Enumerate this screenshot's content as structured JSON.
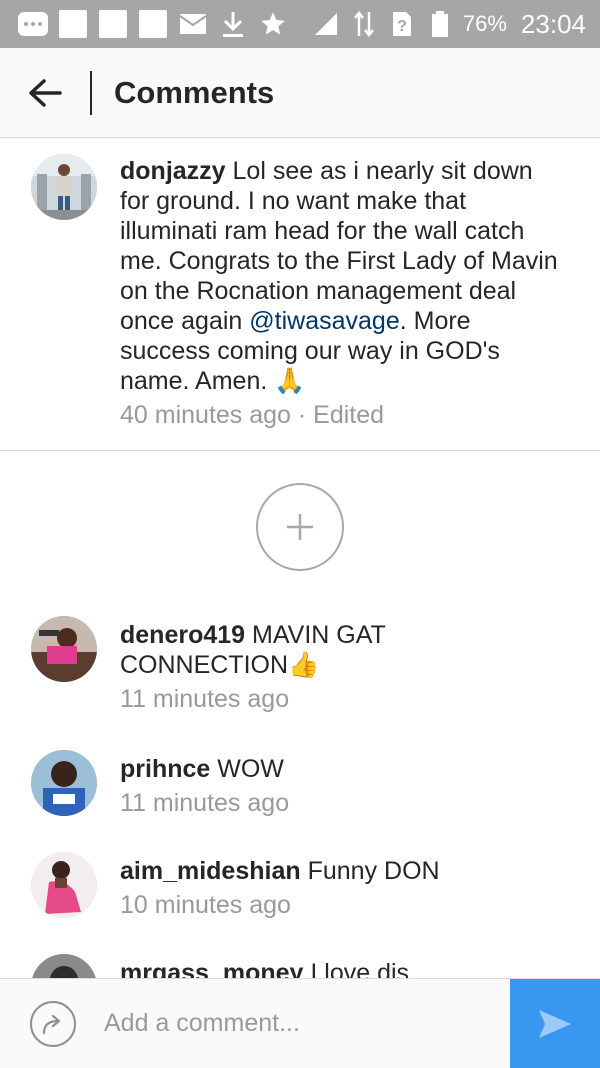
{
  "status_bar": {
    "battery": "76%",
    "time": "23:04"
  },
  "header": {
    "title": "Comments"
  },
  "caption": {
    "username": "donjazzy",
    "text_before_mention": " Lol see as i nearly sit down for ground. I no want make that illuminati ram head for the wall catch me. Congrats to the First Lady of Mavin on the Rocnation management deal once again ",
    "mention": "@tiwasavage",
    "text_after_mention": ". More success coming our way in GOD's name. Amen. 🙏",
    "timestamp": "40 minutes ago",
    "edited": "· Edited"
  },
  "comments": [
    {
      "username": "denero419",
      "text": " MAVIN GAT CONNECTION👍",
      "time": "11 minutes ago"
    },
    {
      "username": "prihnce",
      "text": " WOW",
      "time": "11 minutes ago"
    },
    {
      "username": "aim_mideshian",
      "text": " Funny DON",
      "time": "10 minutes ago"
    },
    {
      "username": "mrgass_money",
      "text": " I love dis",
      "time": ""
    }
  ],
  "input": {
    "placeholder": "Add a comment..."
  },
  "colors": {
    "accent": "#3897f0",
    "mention": "#003569",
    "status_bar": "#a6a6a6"
  }
}
